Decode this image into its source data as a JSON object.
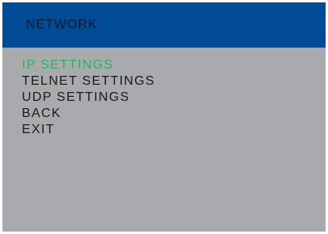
{
  "header": {
    "title": "NETWORK"
  },
  "menu": {
    "items": [
      {
        "label": "IP SETTINGS",
        "selected": true
      },
      {
        "label": "TELNET SETTINGS"
      },
      {
        "label": "UDP SETTINGS"
      },
      {
        "label": "BACK"
      },
      {
        "label": "EXIT"
      }
    ]
  },
  "colors": {
    "header_background": "#004a96",
    "screen_background": "#a9aaad",
    "selected_item": "#2fb35a",
    "item_text": "#1b1b1b"
  }
}
